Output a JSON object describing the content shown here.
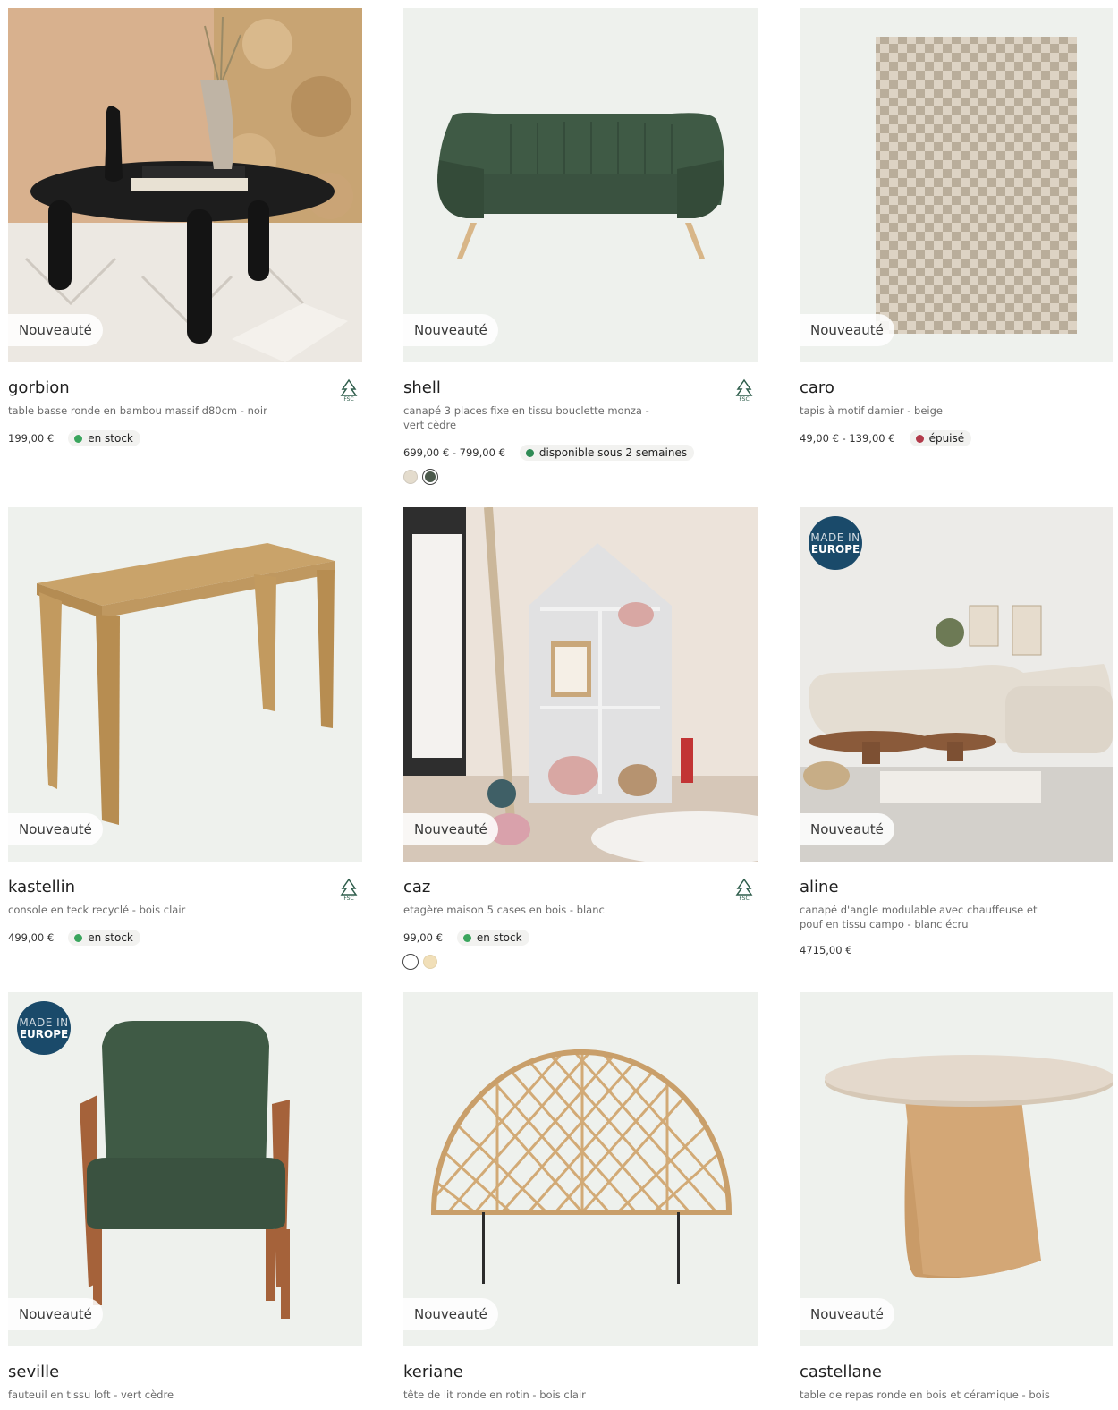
{
  "products": [
    {
      "name": "gorbion",
      "desc": "table basse ronde en bambou massif d80cm - noir",
      "price": "199,00 €",
      "stock": "en stock",
      "stock_color": "#3aa55d",
      "badge": "Nouveauté",
      "fsc": true
    },
    {
      "name": "shell",
      "desc": "canapé 3 places fixe en tissu bouclette monza - vert cèdre",
      "price": "699,00 € - 799,00 €",
      "stock": "disponible sous 2 semaines",
      "stock_color": "#2f8a55",
      "badge": "Nouveauté",
      "fsc": true,
      "swatches": [
        "#e4dccd",
        "#4c5a4c"
      ]
    },
    {
      "name": "caro",
      "desc": "tapis à motif damier - beige",
      "price": "49,00 € - 139,00 €",
      "stock": "épuisé",
      "stock_color": "#b23a4a",
      "badge": "Nouveauté"
    },
    {
      "name": "kastellin",
      "desc": "console en teck recyclé - bois clair",
      "price": "499,00 €",
      "stock": "en stock",
      "stock_color": "#3aa55d",
      "badge": "Nouveauté",
      "fsc": true
    },
    {
      "name": "caz",
      "desc": "etagère maison 5 cases en bois - blanc",
      "price": "99,00 €",
      "stock": "en stock",
      "stock_color": "#3aa55d",
      "badge": "Nouveauté",
      "fsc": true,
      "swatches": [
        "#ffffff",
        "#f1dfb8"
      ]
    },
    {
      "name": "aline",
      "desc": "canapé d'angle modulable avec chauffeuse et pouf en tissu campo - blanc écru",
      "price": "4715,00 €",
      "badge": "Nouveauté",
      "eu": true
    },
    {
      "name": "seville",
      "desc": "fauteuil en tissu loft - vert cèdre",
      "badge": "Nouveauté",
      "eu": true
    },
    {
      "name": "keriane",
      "desc": "tête de lit ronde en rotin - bois clair",
      "badge": "Nouveauté"
    },
    {
      "name": "castellane",
      "desc": "table de repas ronde en bois et céramique - bois",
      "badge": "Nouveauté"
    }
  ],
  "eu_badge": {
    "line1": "MADE IN",
    "line2": "EUROPE"
  },
  "fsc_label": "FSC"
}
